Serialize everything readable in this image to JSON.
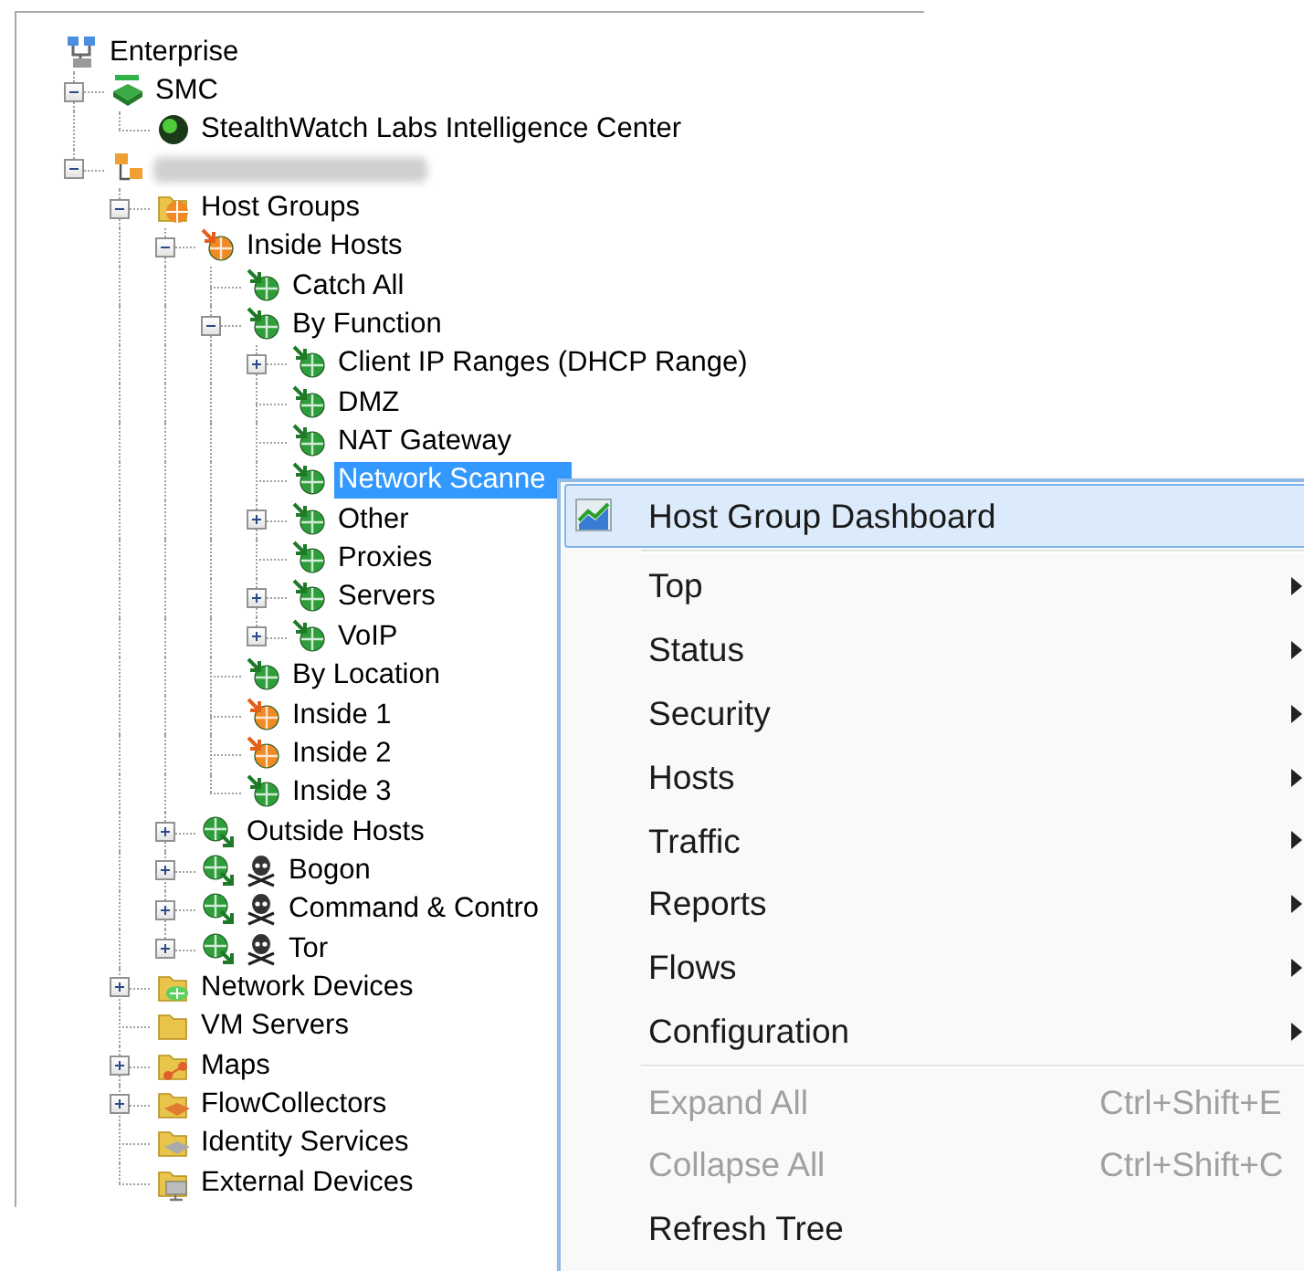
{
  "tree": [
    {
      "label": "Enterprise",
      "kind": "enterprise",
      "selected": false,
      "children": [
        {
          "label": "SMC",
          "kind": "smc",
          "selected": false,
          "expanded": true,
          "children": [
            {
              "label": "StealthWatch Labs Intelligence Center",
              "kind": "intel-center",
              "selected": false
            }
          ]
        },
        {
          "kind": "site",
          "redacted": true,
          "selected": false,
          "expanded": true,
          "children": [
            {
              "label": "Host Groups",
              "kind": "host-groups",
              "selected": false,
              "expanded": true,
              "children": [
                {
                  "label": "Inside Hosts",
                  "kind": "inside",
                  "color": "#f08a24",
                  "selected": false,
                  "expanded": true,
                  "children": [
                    {
                      "label": "Catch All",
                      "kind": "inside",
                      "color": "#2e9e3a",
                      "selected": false
                    },
                    {
                      "label": "By Function",
                      "kind": "inside",
                      "color": "#2e9e3a",
                      "selected": false,
                      "expanded": true,
                      "children": [
                        {
                          "label": "Client IP Ranges (DHCP Range)",
                          "kind": "inside",
                          "color": "#2e9e3a",
                          "selected": false,
                          "expanded": false
                        },
                        {
                          "label": "DMZ",
                          "kind": "inside",
                          "color": "#2e9e3a",
                          "selected": false
                        },
                        {
                          "label": "NAT Gateway",
                          "kind": "inside",
                          "color": "#2e9e3a",
                          "selected": false
                        },
                        {
                          "label": "Network Scanne",
                          "kind": "inside",
                          "color": "#2e9e3a",
                          "selected": true
                        },
                        {
                          "label": "Other",
                          "kind": "inside",
                          "color": "#2e9e3a",
                          "selected": false,
                          "expanded": false
                        },
                        {
                          "label": "Proxies",
                          "kind": "inside",
                          "color": "#2e9e3a",
                          "selected": false
                        },
                        {
                          "label": "Servers",
                          "kind": "inside",
                          "color": "#2e9e3a",
                          "selected": false,
                          "expanded": false
                        },
                        {
                          "label": "VoIP",
                          "kind": "inside",
                          "color": "#2e9e3a",
                          "selected": false,
                          "expanded": false
                        }
                      ]
                    },
                    {
                      "label": "By Location",
                      "kind": "inside",
                      "color": "#2e9e3a",
                      "selected": false
                    },
                    {
                      "label": "Inside 1",
                      "kind": "inside",
                      "color": "#f08a24",
                      "selected": false
                    },
                    {
                      "label": "Inside 2",
                      "kind": "inside",
                      "color": "#f08a24",
                      "selected": false
                    },
                    {
                      "label": "Inside 3",
                      "kind": "inside",
                      "color": "#2e9e3a",
                      "selected": false
                    }
                  ]
                },
                {
                  "label": "Outside Hosts",
                  "kind": "outside",
                  "color": "#2e9e3a",
                  "selected": false,
                  "expanded": false
                },
                {
                  "label": "Bogon",
                  "kind": "threat",
                  "color": "#2e9e3a",
                  "selected": false,
                  "expanded": false
                },
                {
                  "label": "Command & Contro",
                  "kind": "threat",
                  "color": "#2e9e3a",
                  "selected": false,
                  "expanded": false
                },
                {
                  "label": "Tor",
                  "kind": "threat",
                  "color": "#2e9e3a",
                  "selected": false,
                  "expanded": false
                }
              ]
            },
            {
              "label": "Network Devices",
              "kind": "folder-network",
              "selected": false,
              "expanded": false
            },
            {
              "label": "VM Servers",
              "kind": "folder",
              "selected": false
            },
            {
              "label": "Maps",
              "kind": "folder-map",
              "selected": false,
              "expanded": false
            },
            {
              "label": "FlowCollectors",
              "kind": "folder-collector",
              "selected": false,
              "expanded": false
            },
            {
              "label": "Identity Services",
              "kind": "folder-identity",
              "selected": false
            },
            {
              "label": "External Devices",
              "kind": "folder-external",
              "selected": false
            }
          ]
        }
      ]
    }
  ],
  "context_menu": [
    {
      "label": "Host Group Dashboard",
      "kind": "dashboard",
      "selected": true,
      "disabled": false
    },
    {
      "kind": "separator"
    },
    {
      "label": "Top",
      "kind": "submenu",
      "selected": false,
      "disabled": false
    },
    {
      "label": "Status",
      "kind": "submenu",
      "selected": false,
      "disabled": false
    },
    {
      "label": "Security",
      "kind": "submenu",
      "selected": false,
      "disabled": false
    },
    {
      "label": "Hosts",
      "kind": "submenu",
      "selected": false,
      "disabled": false
    },
    {
      "label": "Traffic",
      "kind": "submenu",
      "selected": false,
      "disabled": false
    },
    {
      "label": "Reports",
      "kind": "submenu",
      "selected": false,
      "disabled": false
    },
    {
      "label": "Flows",
      "kind": "submenu",
      "selected": false,
      "disabled": false
    },
    {
      "label": "Configuration",
      "kind": "submenu",
      "selected": false,
      "disabled": false
    },
    {
      "kind": "separator"
    },
    {
      "label": "Expand All",
      "kind": "action",
      "shortcut": "Ctrl+Shift+E",
      "selected": false,
      "disabled": true
    },
    {
      "label": "Collapse All",
      "kind": "action",
      "shortcut": "Ctrl+Shift+C",
      "selected": false,
      "disabled": true
    },
    {
      "label": "Refresh Tree",
      "kind": "action",
      "selected": false,
      "disabled": false
    }
  ]
}
